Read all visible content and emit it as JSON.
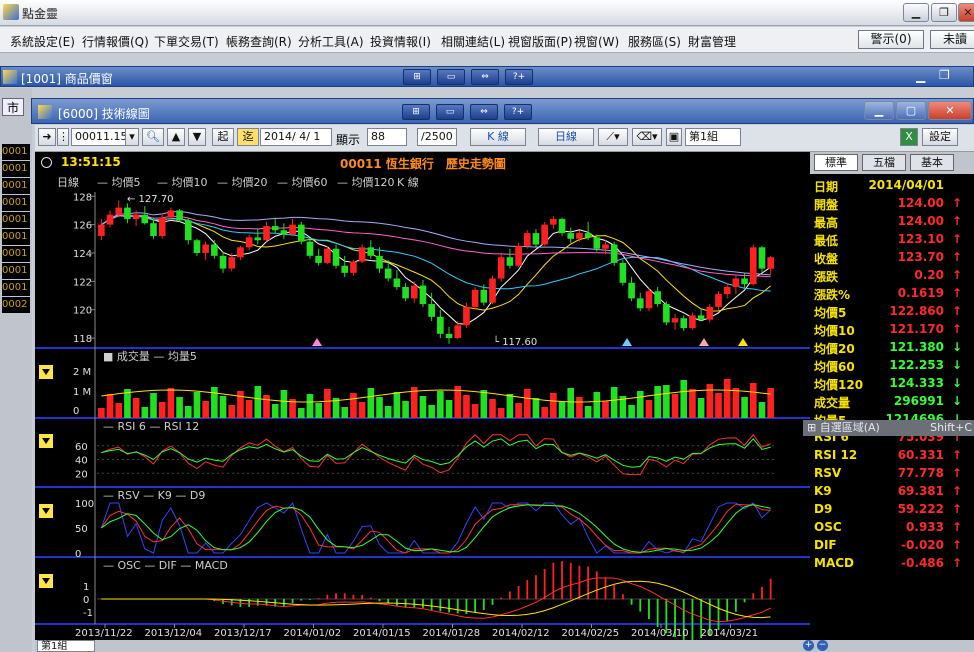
{
  "app": {
    "title": "點金靈",
    "warn_label": "警示(0)",
    "pending_label": "未讀"
  },
  "menu": [
    "系統設定(E)",
    "行情報價(Q)",
    "下單交易(T)",
    "帳務查詢(R)",
    "分析工具(A)",
    "投資情報(I)",
    "相關連結(L)",
    "視窗版面(P)",
    "視窗(W)",
    "服務區(S)",
    "財富管理"
  ],
  "product_window": {
    "title": "[1001] 商品價窗"
  },
  "tech_window": {
    "title": "[6000] 技術線圖"
  },
  "side": {
    "label": "市",
    "codes": [
      "0001",
      "0001",
      "0001",
      "0001",
      "0001",
      "0001",
      "0001",
      "0001",
      "0001",
      "0002"
    ]
  },
  "toolbar": {
    "symbol": "00011.151",
    "btn_start": "起",
    "btn_recent": "迄",
    "date": "2014/ 4/ 1",
    "show_label": "顯示",
    "show_count": "88",
    "total": "/2500",
    "line_type": "K 線",
    "period": "日線",
    "group": "第1組",
    "settings": "設定"
  },
  "chart_header": {
    "time": "13:51:15",
    "title": "00011 恆生銀行　歷史走勢圖"
  },
  "chart_data": [
    {
      "type": "candlestick",
      "legend": [
        "日線",
        "均價5",
        "均價10",
        "均價20",
        "均價60",
        "均價120",
        "K 線"
      ],
      "yticks": [
        118,
        120,
        122,
        124,
        126,
        128
      ],
      "ylim": [
        117.3,
        128.3
      ],
      "annotations": {
        "high": "127.70",
        "low": "117.60"
      },
      "ohlc": [
        [
          125.2,
          126.4,
          124.9,
          126.0
        ],
        [
          126.0,
          127.0,
          125.8,
          126.7
        ],
        [
          126.7,
          127.7,
          126.5,
          127.2
        ],
        [
          127.2,
          127.5,
          126.1,
          126.4
        ],
        [
          126.4,
          127.0,
          125.9,
          126.7
        ],
        [
          126.7,
          127.3,
          126.0,
          126.1
        ],
        [
          126.1,
          126.5,
          125.0,
          125.2
        ],
        [
          125.2,
          126.8,
          125.0,
          126.5
        ],
        [
          126.5,
          127.2,
          126.3,
          127.0
        ],
        [
          127.0,
          127.1,
          126.2,
          126.3
        ],
        [
          126.3,
          126.5,
          124.6,
          124.9
        ],
        [
          124.9,
          125.0,
          123.8,
          124.0
        ],
        [
          124.0,
          124.8,
          123.5,
          124.6
        ],
        [
          124.6,
          124.9,
          123.6,
          123.8
        ],
        [
          123.8,
          124.1,
          122.6,
          122.9
        ],
        [
          122.9,
          124.0,
          122.7,
          123.7
        ],
        [
          123.7,
          124.5,
          123.5,
          124.4
        ],
        [
          124.4,
          125.3,
          124.2,
          125.1
        ],
        [
          125.1,
          125.7,
          124.6,
          124.9
        ],
        [
          124.9,
          126.2,
          124.8,
          125.9
        ],
        [
          125.9,
          126.5,
          125.4,
          125.6
        ],
        [
          125.6,
          126.1,
          125.0,
          125.3
        ],
        [
          125.3,
          126.4,
          125.2,
          126.0
        ],
        [
          126.0,
          126.2,
          124.6,
          124.8
        ],
        [
          124.8,
          125.0,
          123.6,
          123.8
        ],
        [
          123.8,
          124.3,
          123.1,
          123.3
        ],
        [
          123.3,
          124.5,
          123.2,
          124.3
        ],
        [
          124.3,
          124.6,
          122.9,
          123.1
        ],
        [
          123.1,
          123.8,
          122.3,
          122.6
        ],
        [
          122.6,
          123.5,
          122.4,
          123.4
        ],
        [
          123.4,
          124.6,
          123.3,
          124.4
        ],
        [
          124.4,
          124.9,
          123.6,
          123.8
        ],
        [
          123.8,
          124.4,
          122.6,
          122.9
        ],
        [
          122.9,
          123.5,
          122.0,
          122.2
        ],
        [
          122.2,
          122.8,
          121.4,
          121.6
        ],
        [
          121.6,
          121.9,
          120.6,
          120.8
        ],
        [
          120.8,
          122.0,
          120.5,
          121.7
        ],
        [
          121.7,
          122.1,
          120.2,
          120.4
        ],
        [
          120.4,
          121.2,
          119.2,
          119.5
        ],
        [
          119.5,
          120.0,
          118.0,
          118.3
        ],
        [
          118.3,
          118.8,
          117.6,
          118.0
        ],
        [
          118.0,
          119.2,
          117.9,
          118.9
        ],
        [
          118.9,
          120.5,
          118.7,
          120.2
        ],
        [
          120.2,
          121.6,
          120.0,
          121.4
        ],
        [
          121.4,
          121.8,
          120.3,
          120.5
        ],
        [
          120.5,
          122.4,
          120.4,
          122.2
        ],
        [
          122.2,
          123.9,
          122.0,
          123.7
        ],
        [
          123.7,
          124.3,
          122.9,
          123.1
        ],
        [
          123.1,
          124.7,
          123.0,
          124.5
        ],
        [
          124.5,
          125.6,
          124.3,
          125.4
        ],
        [
          125.4,
          125.7,
          124.4,
          124.6
        ],
        [
          124.6,
          126.2,
          124.5,
          126.0
        ],
        [
          126.0,
          126.6,
          125.7,
          126.4
        ],
        [
          126.4,
          126.5,
          125.2,
          125.4
        ],
        [
          125.4,
          125.8,
          124.7,
          125.0
        ],
        [
          125.0,
          125.6,
          124.8,
          125.4
        ],
        [
          125.4,
          126.2,
          124.9,
          125.1
        ],
        [
          125.1,
          125.3,
          124.1,
          124.3
        ],
        [
          124.3,
          124.9,
          123.9,
          124.6
        ],
        [
          124.6,
          124.8,
          123.1,
          123.3
        ],
        [
          123.3,
          123.5,
          121.7,
          121.9
        ],
        [
          121.9,
          122.3,
          120.6,
          120.8
        ],
        [
          120.8,
          121.2,
          119.9,
          120.1
        ],
        [
          120.1,
          121.5,
          119.9,
          121.3
        ],
        [
          121.3,
          121.6,
          120.2,
          120.4
        ],
        [
          120.4,
          120.6,
          118.9,
          119.1
        ],
        [
          119.1,
          119.7,
          118.6,
          119.4
        ],
        [
          119.4,
          119.6,
          118.5,
          118.7
        ],
        [
          118.7,
          119.8,
          118.6,
          119.6
        ],
        [
          119.6,
          120.1,
          119.2,
          119.3
        ],
        [
          119.3,
          120.4,
          119.1,
          120.2
        ],
        [
          120.2,
          121.3,
          120.0,
          121.1
        ],
        [
          121.1,
          121.9,
          120.8,
          121.6
        ],
        [
          121.6,
          122.4,
          121.1,
          122.2
        ],
        [
          122.2,
          122.6,
          121.5,
          121.8
        ],
        [
          121.8,
          124.6,
          121.7,
          124.4
        ],
        [
          124.4,
          124.5,
          122.6,
          122.9
        ],
        [
          122.9,
          123.8,
          122.5,
          123.7
        ]
      ],
      "xlabels": [
        "2013/11/22",
        "2013/12/04",
        "2013/12/17",
        "2014/01/02",
        "2014/01/15",
        "2014/01/28",
        "2014/02/12",
        "2014/02/25",
        "2014/03/10",
        "2014/03/21"
      ]
    },
    {
      "type": "bar",
      "legend": [
        "成交量",
        "均量5"
      ],
      "yticks": [
        "2 M",
        "1 M",
        "0"
      ]
    },
    {
      "type": "line",
      "legend": [
        "RSI 6",
        "RSI 12"
      ],
      "yticks": [
        60,
        40,
        20
      ]
    },
    {
      "type": "line",
      "legend": [
        "RSV",
        "K9",
        "D9"
      ],
      "yticks": [
        100,
        50,
        0
      ]
    },
    {
      "type": "bar",
      "legend": [
        "OSC",
        "DIF",
        "MACD"
      ],
      "yticks": [
        1,
        0,
        -1
      ]
    }
  ],
  "quote": {
    "tabs": [
      "標準",
      "五檔",
      "基本"
    ],
    "rows": [
      {
        "k": "日期",
        "v": "2014/04/01",
        "c": "#f5e200",
        "a": ""
      },
      {
        "k": "開盤",
        "v": "124.00",
        "c": "#ff2a2a",
        "a": "↑"
      },
      {
        "k": "最高",
        "v": "124.00",
        "c": "#ff2a2a",
        "a": "↑"
      },
      {
        "k": "最低",
        "v": "123.10",
        "c": "#ff2a2a",
        "a": "↑"
      },
      {
        "k": "收盤",
        "v": "123.70",
        "c": "#ff2a2a",
        "a": "↑"
      },
      {
        "k": "漲跌",
        "v": "0.20",
        "c": "#ff2a2a",
        "a": "↑"
      },
      {
        "k": "漲跌%",
        "v": "0.1619",
        "c": "#ff2a2a",
        "a": "↑"
      },
      {
        "k": "均價5",
        "v": "122.860",
        "c": "#ff2a2a",
        "a": "↑"
      },
      {
        "k": "均價10",
        "v": "121.170",
        "c": "#ff2a2a",
        "a": "↑"
      },
      {
        "k": "均價20",
        "v": "121.380",
        "c": "#33ff33",
        "a": "↓"
      },
      {
        "k": "均價60",
        "v": "122.253",
        "c": "#33ff33",
        "a": "↓"
      },
      {
        "k": "均價120",
        "v": "124.333",
        "c": "#33ff33",
        "a": "↓"
      },
      {
        "k": "成交量",
        "v": "296991",
        "c": "#33ff33",
        "a": "↓"
      },
      {
        "k": "均量5",
        "v": "1214696",
        "c": "#33ff33",
        "a": "↓"
      },
      {
        "k": "RSI 6",
        "v": "75.039",
        "c": "#ff2a2a",
        "a": "↑"
      },
      {
        "k": "RSI 12",
        "v": "60.331",
        "c": "#ff2a2a",
        "a": "↑"
      },
      {
        "k": "RSV",
        "v": "77.778",
        "c": "#ff2a2a",
        "a": "↑"
      },
      {
        "k": "K9",
        "v": "69.381",
        "c": "#ff2a2a",
        "a": "↑"
      },
      {
        "k": "D9",
        "v": "59.222",
        "c": "#ff2a2a",
        "a": "↑"
      },
      {
        "k": "OSC",
        "v": "0.933",
        "c": "#ff2a2a",
        "a": "↑"
      },
      {
        "k": "DIF",
        "v": "-0.020",
        "c": "#ff2a2a",
        "a": "↑"
      },
      {
        "k": "MACD",
        "v": "-0.486",
        "c": "#ff2a2a",
        "a": "↑"
      }
    ]
  },
  "tooltip": {
    "label": "自選區域(A)",
    "shortcut": "Shift+C"
  },
  "bottom": {
    "group": "第1組"
  }
}
